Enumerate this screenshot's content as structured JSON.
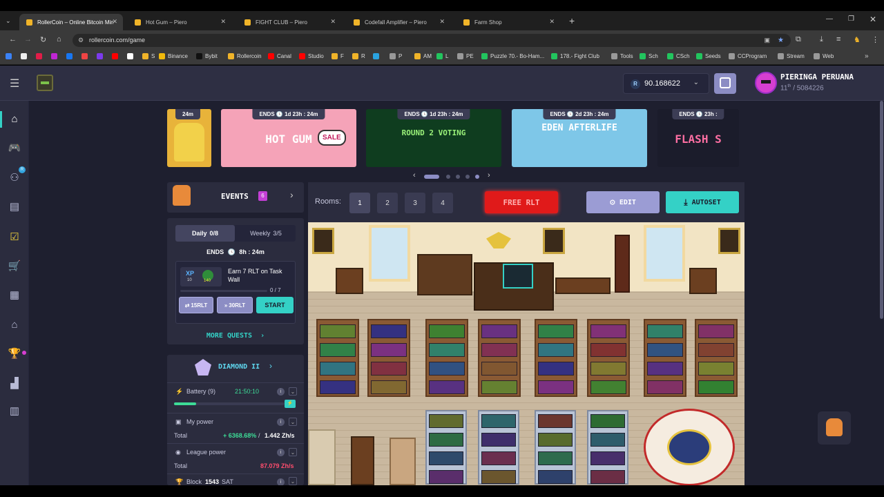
{
  "browser": {
    "tabs": [
      {
        "title": "RollerCoin – Online Bitcoin Min",
        "color": "#f0b429",
        "active": true
      },
      {
        "title": "Hot Gum – Piero",
        "color": "#f0b429",
        "active": false
      },
      {
        "title": "FIGHT CLUB – Piero",
        "color": "#f0b429",
        "active": false
      },
      {
        "title": "Codefall Amplifier – Piero",
        "color": "#f0b429",
        "active": false
      },
      {
        "title": "Farm Shop",
        "color": "#f0b429",
        "active": false
      }
    ],
    "new_tab": "+",
    "url": "rollercoin.com/game",
    "bookmarks": [
      {
        "label": "",
        "color": "#3b82f6"
      },
      {
        "label": "",
        "color": "#eee"
      },
      {
        "label": "",
        "color": "#e11d48"
      },
      {
        "label": "",
        "color": "#c026d3"
      },
      {
        "label": "",
        "color": "#1877f2"
      },
      {
        "label": "",
        "color": "#ef4444"
      },
      {
        "label": "",
        "color": "#7c3aed"
      },
      {
        "label": "",
        "color": "#ff0000"
      },
      {
        "label": "",
        "color": "#ffffff"
      },
      {
        "label": "S",
        "color": "#f0b429"
      },
      {
        "label": "Binance",
        "color": "#f0b90b"
      },
      {
        "label": "Bybit",
        "color": "#111"
      },
      {
        "label": "Rollercoin",
        "color": "#f0b429"
      },
      {
        "label": "Canal",
        "color": "#ff0000"
      },
      {
        "label": "Studio",
        "color": "#ff0000"
      },
      {
        "label": "F",
        "color": "#f0b429"
      },
      {
        "label": "R",
        "color": "#f0b429"
      },
      {
        "label": "",
        "color": "#2aa3e0"
      },
      {
        "label": "P",
        "color": "#999"
      },
      {
        "label": "AM",
        "color": "#f0b429"
      },
      {
        "label": "L",
        "color": "#22c55e"
      },
      {
        "label": "PE",
        "color": "#999"
      },
      {
        "label": "Puzzle 70.- Bo-Ham...",
        "color": "#22c55e"
      },
      {
        "label": "178.- Fight Club",
        "color": "#22c55e"
      },
      {
        "label": "Tools",
        "color": "#999"
      },
      {
        "label": "Sch",
        "color": "#22c55e"
      },
      {
        "label": "CSch",
        "color": "#22c55e"
      },
      {
        "label": "Seeds",
        "color": "#22c55e"
      },
      {
        "label": "CCProgram",
        "color": "#999"
      },
      {
        "label": "Stream",
        "color": "#999"
      },
      {
        "label": "Web",
        "color": "#999"
      }
    ],
    "bookmarks_more": "»"
  },
  "header": {
    "balance_currency": "R",
    "balance": "90.168622",
    "username": "PIERINGA PERUANA",
    "rank": "11",
    "rank_suffix": "th",
    "rank_total": "/ 5084226"
  },
  "banners": [
    {
      "ends": "",
      "text": "",
      "color": "#e8b33a"
    },
    {
      "ends": "ENDS 🕓 1d 23h : 24m",
      "text": "HOT GUM",
      "badge": "SALE",
      "color": "#f5a3b8"
    },
    {
      "ends": "ENDS 🕓 1d 23h : 24m",
      "text": "ROUND 2 VOTING",
      "color": "#0f3d1f"
    },
    {
      "ends": "ENDS 🕓 2d 23h : 24m",
      "text": "EDEN AFTERLIFE",
      "color": "#7ec7e8"
    },
    {
      "ends": "ENDS 🕓 23h :",
      "text": "FLASH S",
      "color": "#1b1c2b"
    }
  ],
  "banners_first_time": "24m",
  "events": {
    "title": "EVENTS",
    "count": "6",
    "tabs": [
      {
        "label": "Daily",
        "progress": "0/8",
        "active": true
      },
      {
        "label": "Weekly",
        "progress": "3/5",
        "active": false
      }
    ],
    "ends_label": "ENDS",
    "ends_time": "8h : 24m",
    "quest": {
      "title": "Earn 7 RLT on Task Wall",
      "xp": "10",
      "reward": "140",
      "progress": "0 / 7",
      "progress_fraction": 0.0
    },
    "buttons": {
      "rlt15": "15RLT",
      "rlt30": "30RLT",
      "start": "START"
    },
    "more": "MORE QUESTS"
  },
  "league": {
    "title": "DIAMOND II",
    "battery_label": "Battery (9)",
    "battery_time": "21:50:10",
    "battery_fraction": 0.2,
    "my_power_label": "My power",
    "total_label": "Total",
    "my_power_pct": "+ 6368.68%",
    "my_power_value": "1.442 Zh/s",
    "league_power_label": "League power",
    "league_total": "87.079 Zh/s",
    "block_label": "Block",
    "block_value": "1543",
    "block_unit": "SAT"
  },
  "rooms": {
    "label": "Rooms:",
    "numbers": [
      "1",
      "2",
      "3",
      "4"
    ],
    "active": "1",
    "free_rlt": "FREE RLT",
    "edit": "EDIT",
    "autoset": "AUTOSET"
  },
  "colors": {
    "accent_teal": "#34d1c6",
    "accent_purple": "#9b9cd4",
    "free_red": "#e01a1a",
    "league_red": "#ff4d6d",
    "power_green": "#3ddc97",
    "events_badge": "#c43fd6"
  }
}
